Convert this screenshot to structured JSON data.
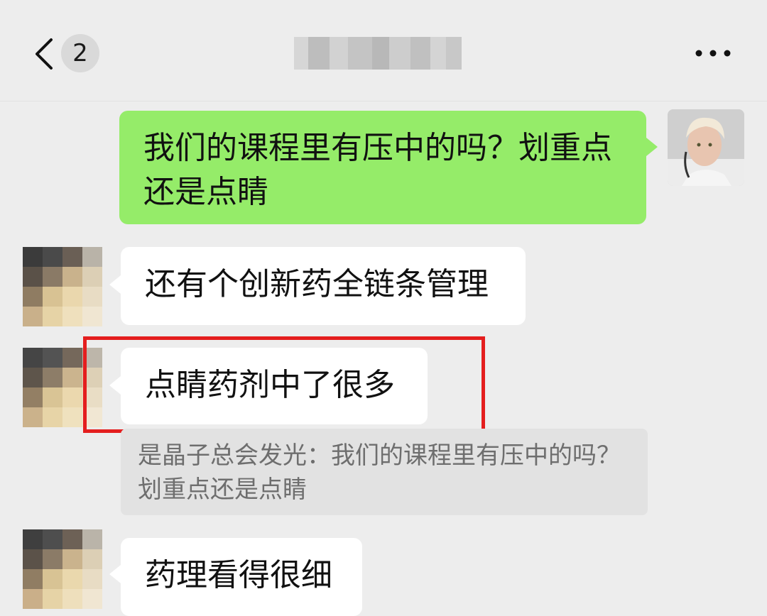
{
  "header": {
    "back_icon": "chevron-left-icon",
    "unread_count": "2",
    "more_icon": "more-dots-icon"
  },
  "messages": [
    {
      "direction": "out",
      "text": "我们的课程里有压中的吗？划重点还是点睛"
    },
    {
      "direction": "in",
      "text": "还有个创新药全链条管理"
    },
    {
      "direction": "in",
      "text": "点睛药剂中了很多",
      "highlighted": true,
      "quote": "是晶子总会发光：我们的课程里有压中的吗？划重点还是点睛"
    },
    {
      "direction": "in",
      "text": "药理看得很细"
    }
  ],
  "colors": {
    "background": "#ededed",
    "outgoing_bubble": "#95ec69",
    "incoming_bubble": "#ffffff",
    "highlight": "#e41e1e",
    "quote_bg": "#e2e2e2"
  }
}
